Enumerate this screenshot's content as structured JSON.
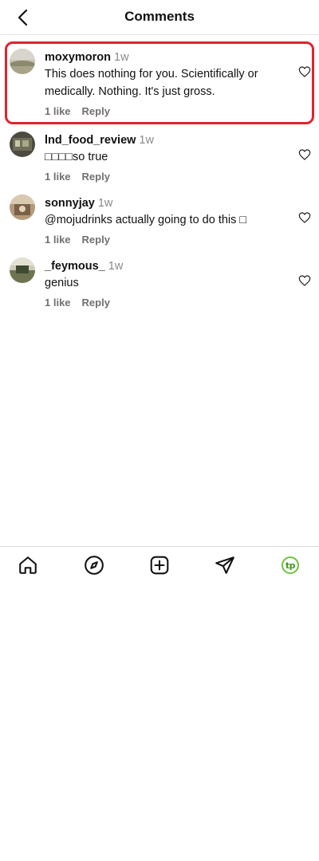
{
  "header": {
    "title": "Comments",
    "back_icon": "chevron-left-icon"
  },
  "comments": [
    {
      "username": "moxymoron",
      "time": "1w",
      "text": "This does nothing for you. Scientifically or medically. Nothing. It's just gross.",
      "likes": "1 like",
      "reply": "Reply",
      "highlighted": true
    },
    {
      "username": "lnd_food_review",
      "time": "1w",
      "text": "□□□□so true",
      "likes": "1 like",
      "reply": "Reply"
    },
    {
      "username": "sonnyjay",
      "time": "1w",
      "text": "@mojudrinks actually going to do this □",
      "likes": "1 like",
      "reply": "Reply"
    },
    {
      "username": "_feymous_",
      "time": "1w",
      "text": "genius",
      "likes": "1 like",
      "reply": "Reply"
    }
  ],
  "tabbar": {
    "items": [
      "home-icon",
      "explore-icon",
      "create-icon",
      "direct-icon",
      "profile-icon"
    ],
    "profile_logo_text": "tp",
    "accent_color": "#6cc43b"
  },
  "colors": {
    "highlight_border": "#e0232e"
  }
}
